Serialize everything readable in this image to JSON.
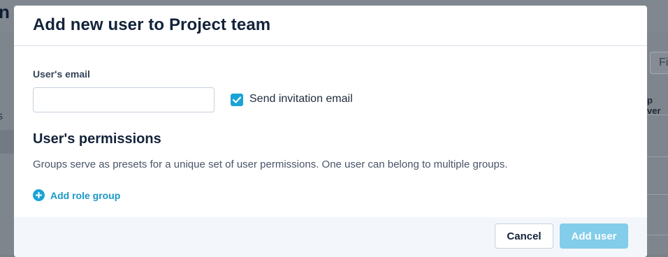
{
  "background": {
    "page_title": "n",
    "side_mark": "s",
    "filter_text": "Fi",
    "column_header": "p ver"
  },
  "modal": {
    "title": "Add new user to Project team",
    "email": {
      "label": "User's email",
      "value": "",
      "placeholder": ""
    },
    "invitation": {
      "label": "Send invitation email",
      "checked": true
    },
    "permissions": {
      "heading": "User's permissions",
      "description": "Groups serve as presets for a unique set of user permissions. One user can belong to multiple groups.",
      "add_role_label": "Add role group"
    },
    "footer": {
      "cancel_label": "Cancel",
      "add_label": "Add user"
    }
  },
  "colors": {
    "accent": "#1aa3d6",
    "primary_disabled": "#82cdea",
    "title_text": "#13233a"
  },
  "icons": {
    "checkbox": "check-icon",
    "add_role": "plus-circle-icon"
  }
}
